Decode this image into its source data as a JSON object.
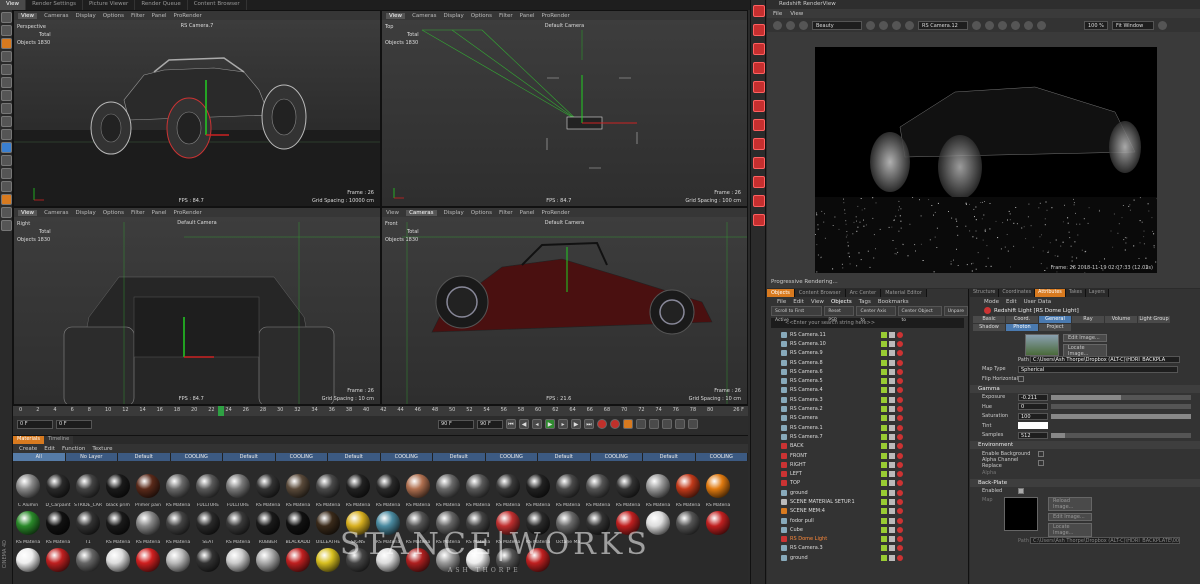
{
  "top_tabs": [
    "View",
    "Render Settings",
    "Picture Viewer",
    "Render Queue",
    "Content Browser"
  ],
  "viewports": [
    {
      "menu": [
        "View",
        "Cameras",
        "Display",
        "Options",
        "Filter",
        "Panel",
        "ProRender"
      ],
      "name": "Perspective",
      "camera": "RS Camera.7",
      "total": "Total",
      "objects_label": "Objects",
      "objects": "1830",
      "fps": "FPS : 84.7",
      "grid": "Grid Spacing : 10000 cm",
      "frame": "Frame : 26"
    },
    {
      "menu": [
        "View",
        "Cameras",
        "Display",
        "Options",
        "Filter",
        "Panel",
        "ProRender"
      ],
      "name": "Top",
      "camera": "Default Camera",
      "total": "Total",
      "objects_label": "Objects",
      "objects": "1830",
      "fps": "FPS : 84.7",
      "grid": "Grid Spacing : 100 cm",
      "frame": "Frame : 26"
    },
    {
      "menu": [
        "View",
        "Cameras",
        "Display",
        "Options",
        "Filter",
        "Panel",
        "ProRender"
      ],
      "name": "Right",
      "camera": "Default Camera",
      "total": "Total",
      "objects_label": "Objects",
      "objects": "1830",
      "fps": "FPS : 84.7",
      "grid": "Grid Spacing : 10 cm",
      "frame": "Frame : 26"
    },
    {
      "menu": [
        "View",
        "Cameras",
        "Display",
        "Options",
        "Filter",
        "Panel",
        "ProRender"
      ],
      "name": "Front",
      "camera": "Default Camera",
      "total": "Total",
      "objects_label": "Objects",
      "objects": "1830",
      "fps": "FPS : 21.6",
      "grid": "Grid Spacing : 10 cm",
      "frame": "Frame : 26"
    }
  ],
  "timeline": {
    "ticks": [
      "0",
      "2",
      "4",
      "6",
      "8",
      "10",
      "12",
      "14",
      "16",
      "18",
      "20",
      "22",
      "24",
      "26",
      "28",
      "30",
      "32",
      "34",
      "36",
      "38",
      "40",
      "42",
      "44",
      "46",
      "48",
      "50",
      "52",
      "54",
      "56",
      "58",
      "60",
      "62",
      "64",
      "66",
      "68",
      "70",
      "72",
      "74",
      "76",
      "78",
      "80"
    ],
    "current_frame": "26",
    "end_frame_display": "26 F",
    "start_field": "0 F",
    "min_field": "0 F",
    "max_field": "90 F",
    "max_field2": "90 F"
  },
  "materials": {
    "tabs": [
      "Materials",
      "Timeline"
    ],
    "menu": [
      "Create",
      "Edit",
      "Function",
      "Texture"
    ],
    "layers": [
      "All",
      "No Layer",
      "Default",
      "COOLING",
      "Default",
      "COOLING",
      "Default",
      "COOLING",
      "Default",
      "COOLING",
      "Default",
      "COOLING",
      "Default",
      "COOLING"
    ],
    "swatches": [
      {
        "label": "C Alumin",
        "color": "#8a8a8a"
      },
      {
        "label": "D_Carpaint",
        "color": "#2a2a2a"
      },
      {
        "label": "STRIDE_CAR",
        "color": "#444"
      },
      {
        "label": "black prim",
        "color": "#1a1a1a"
      },
      {
        "label": "Primer pain",
        "color": "#5a2a1a"
      },
      {
        "label": "RS Materia",
        "color": "#6a6a6a"
      },
      {
        "label": "FULLTURE",
        "color": "#5a5a5a"
      },
      {
        "label": "FULLTURE",
        "color": "#7a7a7a"
      },
      {
        "label": "RS Materia",
        "color": "#333"
      },
      {
        "label": "RS Materia",
        "color": "#5a4a3a"
      },
      {
        "label": "RS Materia",
        "color": "#4a4a4a"
      },
      {
        "label": "RS Materia",
        "color": "#222"
      },
      {
        "label": "RS Materia",
        "color": "#2a2a2a"
      },
      {
        "label": "RS Materia",
        "color": "#b07050"
      },
      {
        "label": "RS Materia",
        "color": "#6a6a6a"
      },
      {
        "label": "RS Materia",
        "color": "#5a5a5a"
      },
      {
        "label": "RS Materia",
        "color": "#3a3a3a"
      },
      {
        "label": "RS Materia",
        "color": "#222"
      },
      {
        "label": "RS Materia",
        "color": "#4a4a4a"
      },
      {
        "label": "RS Materia",
        "color": "#555"
      },
      {
        "label": "RS Materia",
        "color": "#333"
      },
      {
        "label": "RS Materia",
        "color": "#999"
      },
      {
        "label": "RS Materia",
        "color": "#c23a1a"
      },
      {
        "label": "RS Materia",
        "color": "#e07a10"
      },
      {
        "label": "RS Materia",
        "color": "#2a8a2a"
      },
      {
        "label": "RS Materia",
        "color": "#111"
      },
      {
        "label": "T1",
        "color": "#333"
      },
      {
        "label": "RS Materia",
        "color": "#1a1a1a"
      },
      {
        "label": "RS Materia",
        "color": "#888"
      },
      {
        "label": "RS Materia",
        "color": "#444"
      },
      {
        "label": "SEAT",
        "color": "#2a2a2a"
      },
      {
        "label": "RS Materia",
        "color": "#3a3a3a"
      },
      {
        "label": "RUBBER",
        "color": "#1a1a1a"
      },
      {
        "label": "BLACKADD",
        "color": "#111"
      },
      {
        "label": "OILLEATHE",
        "color": "#3a2a1a"
      },
      {
        "label": "SIGNS",
        "color": "#d8b020"
      },
      {
        "label": "RS Materia",
        "color": "#4a8aa0"
      },
      {
        "label": "RS Materia",
        "color": "#555"
      },
      {
        "label": "RS Materia",
        "color": "#666"
      },
      {
        "label": "RS Materia",
        "color": "#444"
      },
      {
        "label": "RS Materia",
        "color": "#c03030"
      },
      {
        "label": "RS Materia",
        "color": "#2a2a2a"
      },
      {
        "label": "Octane Ma",
        "color": "#6a6a6a"
      },
      {
        "label": "",
        "color": "#333"
      },
      {
        "label": "",
        "color": "#c02020"
      },
      {
        "label": "",
        "color": "#ddd"
      },
      {
        "label": "",
        "color": "#555"
      },
      {
        "label": "",
        "color": "#c02020"
      },
      {
        "label": "",
        "color": "#eee"
      },
      {
        "label": "",
        "color": "#c02020"
      },
      {
        "label": "",
        "color": "#666"
      },
      {
        "label": "",
        "color": "#ddd"
      },
      {
        "label": "",
        "color": "#d02020"
      },
      {
        "label": "",
        "color": "#bbb"
      },
      {
        "label": "",
        "color": "#333"
      },
      {
        "label": "",
        "color": "#ccc"
      },
      {
        "label": "",
        "color": "#aaa"
      },
      {
        "label": "",
        "color": "#c02020"
      },
      {
        "label": "",
        "color": "#d8c020"
      },
      {
        "label": "",
        "color": "#444"
      },
      {
        "label": "",
        "color": "#ddd"
      },
      {
        "label": "",
        "color": "#b02020"
      },
      {
        "label": "",
        "color": "#999"
      },
      {
        "label": "",
        "color": "#eee"
      },
      {
        "label": "",
        "color": "#555"
      },
      {
        "label": "",
        "color": "#c02020"
      }
    ]
  },
  "render_view": {
    "title": "Redshift RenderView",
    "menu": [
      "File",
      "View"
    ],
    "aov": "Beauty",
    "camera": "RS Camera.12",
    "zoom": "100 %",
    "fit": "Fit Window",
    "frame_info": "Frame: 26  2018-11-19 02:07:33 (12.03s)",
    "status": "Progressive Rendering..."
  },
  "objects": {
    "tabs": [
      "Objects",
      "Content Browser",
      "Arc Center",
      "Material Editor"
    ],
    "menu": [
      "File",
      "Edit",
      "View",
      "Objects",
      "Tags",
      "Bookmarks"
    ],
    "buttons": [
      "Scroll to First Active",
      "Reset PSR",
      "Center Axis to",
      "Center Object to",
      "Unpare"
    ],
    "search_placeholder": "<<Enter your search string here>>",
    "rows": [
      {
        "name": "RS Camera.11",
        "color": "#8ab"
      },
      {
        "name": "RS Camera.10",
        "color": "#8ab"
      },
      {
        "name": "RS Camera.9",
        "color": "#8ab"
      },
      {
        "name": "RS Camera.8",
        "color": "#8ab"
      },
      {
        "name": "RS Camera.6",
        "color": "#8ab"
      },
      {
        "name": "RS Camera.5",
        "color": "#8ab"
      },
      {
        "name": "RS Camera.4",
        "color": "#8ab"
      },
      {
        "name": "RS Camera.3",
        "color": "#8ab"
      },
      {
        "name": "RS Camera.2",
        "color": "#8ab"
      },
      {
        "name": "RS Camera",
        "color": "#8ab"
      },
      {
        "name": "RS Camera.1",
        "color": "#8ab"
      },
      {
        "name": "RS Camera.7",
        "color": "#8ab"
      },
      {
        "name": "BACK",
        "color": "#c33"
      },
      {
        "name": "FRONT",
        "color": "#c33"
      },
      {
        "name": "RIGHT",
        "color": "#c33"
      },
      {
        "name": "LEFT",
        "color": "#c33"
      },
      {
        "name": "TOP",
        "color": "#c33"
      },
      {
        "name": "ground",
        "color": "#8ab"
      },
      {
        "name": "SCENE MATERIAL SETUP.1",
        "color": "#bbb"
      },
      {
        "name": "SCENE MEM:4",
        "color": "#d87a1f"
      },
      {
        "name": "fodor pull",
        "color": "#8ab"
      },
      {
        "name": "Cube",
        "color": "#8ab"
      },
      {
        "name": "RS Dome Light",
        "color": "#c33"
      },
      {
        "name": "RS Camera.3",
        "color": "#8ab"
      },
      {
        "name": "ground",
        "color": "#8ab"
      }
    ]
  },
  "attributes": {
    "tabs": [
      "Structure",
      "Coordinates",
      "Attributes",
      "Takes",
      "Layers"
    ],
    "menu": [
      "Mode",
      "Edit",
      "User Data"
    ],
    "title": "Redshift Light [RS Dome Light]",
    "subtabs": [
      "Basic",
      "Coord.",
      "General",
      "Ray",
      "Volume",
      "Light Group",
      "Shadow",
      "Photon",
      "Project"
    ],
    "edit_image": "Edit Image...",
    "locate_image": "Locate Image...",
    "path_label": "Path",
    "path_value": "C:\\Users\\Ash Thorpe\\Dropbox (ALT-C)\\HDRI_BACKPLA",
    "map_type_label": "Map Type",
    "map_type_value": "Spherical",
    "flip_label": "Flip Horizontal",
    "gamma_section": "Gamma",
    "exposure_label": "Exposure",
    "exposure_value": "-0.211",
    "hue_label": "Hue",
    "hue_value": "0",
    "saturation_label": "Saturation",
    "saturation_value": "100",
    "tint_label": "Tint",
    "samples_label": "Samples",
    "samples_value": "512",
    "environment_section": "Environment",
    "enable_bg_label": "Enable Background",
    "alpha_label": "Alpha Channel Replace",
    "alpha_sub": "Alpha",
    "backplate_section": "Back-Plate",
    "enabled_label": "Enabled",
    "map_label": "Map",
    "reload_image": "Reload Image...",
    "edit_image2": "Edit Image...",
    "locate_image2": "Locate Image...",
    "path2_value": "C:\\Users\\Ash Thorpe\\Dropbox (ALT-C)\\HDRI_BACKPLATE\\004"
  },
  "watermark": "STANCE|WORKS",
  "watermark_sub": "ASH THORPE",
  "c4d_label": "CINEMA 4D"
}
